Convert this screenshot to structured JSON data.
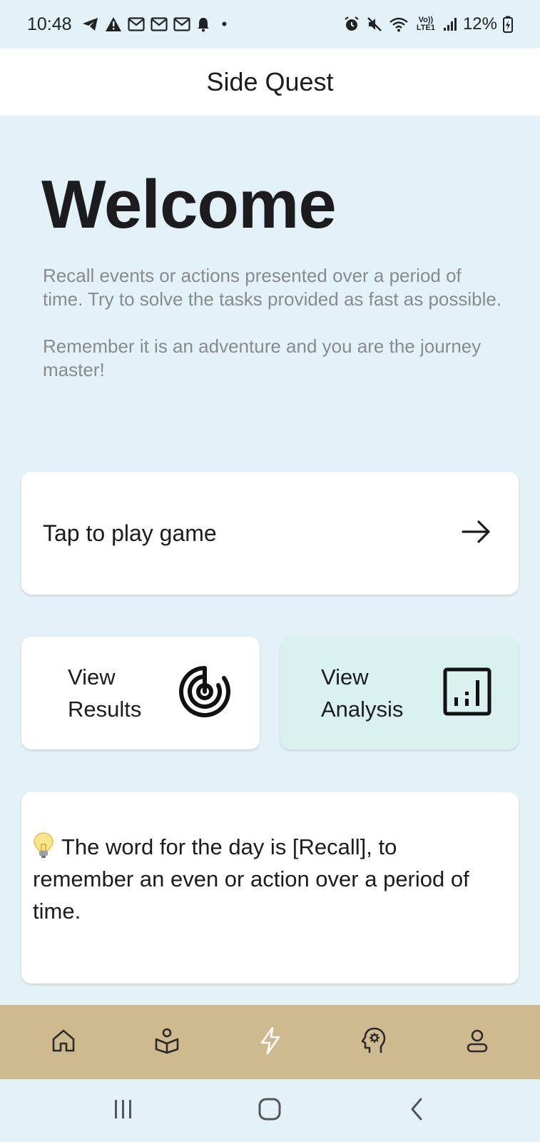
{
  "status_bar": {
    "time": "10:48",
    "battery": "12%",
    "network_label": "Vo)) LTE1",
    "left_icons": [
      "telegram-icon",
      "alert-icon",
      "gmail-icon",
      "gmail-icon",
      "gmail-icon",
      "notification-bell-icon",
      "dot-icon"
    ],
    "right_icons": [
      "alarm-icon",
      "mute-icon",
      "wifi-icon",
      "lte-icon",
      "signal-icon",
      "battery-charging-icon"
    ]
  },
  "header": {
    "title": "Side Quest"
  },
  "welcome": {
    "title": "Welcome",
    "paragraph_1": "Recall events or actions presented over a period of time. Try to solve the tasks provided as fast as possible.",
    "paragraph_2": "Remember it is an adventure and you are the journey master!"
  },
  "play_card": {
    "label": "Tap to play game",
    "icon": "arrow-right-icon"
  },
  "results_card": {
    "line_1": "View",
    "line_2": "Results",
    "icon": "radar-icon"
  },
  "analysis_card": {
    "line_1": "View",
    "line_2": "Analysis",
    "icon": "bar-chart-icon"
  },
  "word_card": {
    "icon": "lightbulb-icon",
    "text": "The word for the day is [Recall], to remember an even or action over a period of time."
  },
  "bottom_nav": {
    "items": [
      {
        "name": "home",
        "icon": "home-icon"
      },
      {
        "name": "learn",
        "icon": "reading-person-icon"
      },
      {
        "name": "quest",
        "icon": "lightning-icon"
      },
      {
        "name": "mind",
        "icon": "head-gear-icon"
      },
      {
        "name": "profile",
        "icon": "user-icon"
      }
    ]
  },
  "system_nav": {
    "items": [
      "recents-icon",
      "home-button-icon",
      "back-icon"
    ]
  },
  "colors": {
    "background": "#e3f2f8",
    "header": "#ffffff",
    "card": "#ffffff",
    "analysis_card": "#d9f2f0",
    "bottom_nav": "#cfb98e",
    "muted_text": "#8a8a8a"
  }
}
